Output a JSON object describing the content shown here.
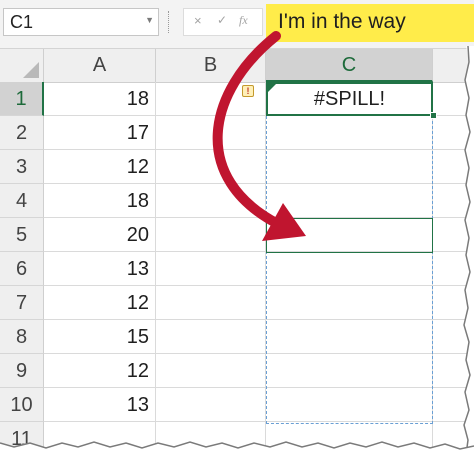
{
  "formula_bar": {
    "name_box": "C1",
    "name_box_dropdown_icon": "chevron-down-icon",
    "cancel_glyph": "×",
    "enter_glyph": "✓",
    "function_glyph": "fx",
    "callout_text": "I'm in the way",
    "callout_color": "#ffec4a"
  },
  "columns": [
    "A",
    "B",
    "C"
  ],
  "selected_column": "C",
  "rows": [
    "1",
    "2",
    "3",
    "4",
    "5",
    "6",
    "7",
    "8",
    "9",
    "10",
    "11"
  ],
  "selected_row": "1",
  "column_a_values": [
    "18",
    "17",
    "12",
    "18",
    "20",
    "13",
    "12",
    "15",
    "12",
    "13"
  ],
  "spill_cell": {
    "address": "C1",
    "value": "#SPILL!"
  },
  "error_indicator_glyph": "!",
  "colors": {
    "accent_green": "#217346",
    "arrow_red": "#c0152f",
    "spill_dashed_border": "#6a9fd4"
  }
}
